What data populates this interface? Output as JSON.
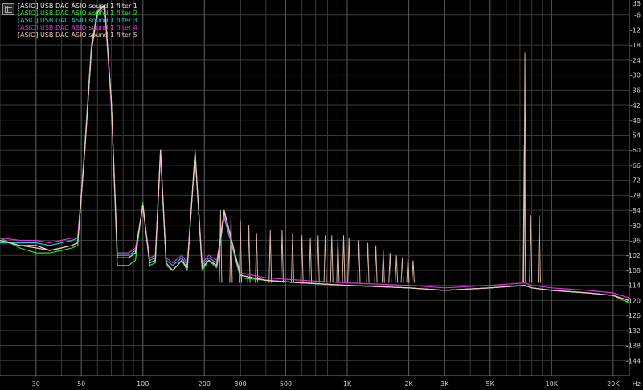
{
  "chart_data": {
    "type": "line",
    "ylabel": "dB",
    "xlabel": "Hz",
    "x_scale": "log",
    "xlim": [
      20,
      24000
    ],
    "ylim": [
      -150,
      0
    ],
    "grid": true,
    "legend_position": "top-left",
    "xticks": [
      {
        "value": 30,
        "label": "30"
      },
      {
        "value": 50,
        "label": "50"
      },
      {
        "value": 100,
        "label": "100"
      },
      {
        "value": 200,
        "label": "200"
      },
      {
        "value": 300,
        "label": "300"
      },
      {
        "value": 500,
        "label": "500"
      },
      {
        "value": 1000,
        "label": "1K"
      },
      {
        "value": 2000,
        "label": "2K"
      },
      {
        "value": 3000,
        "label": "3K"
      },
      {
        "value": 5000,
        "label": "5K"
      },
      {
        "value": 10000,
        "label": "10K"
      },
      {
        "value": 20000,
        "label": "20K"
      }
    ],
    "yticks": [
      "-6",
      "-12",
      "-18",
      "-24",
      "-30",
      "-36",
      "-42",
      "-48",
      "-54",
      "-60",
      "-66",
      "-72",
      "-78",
      "-84",
      "-90",
      "-96",
      "-102",
      "-108",
      "-114",
      "-120",
      "-126",
      "-132",
      "-138",
      "-144"
    ],
    "series": [
      {
        "name": "[ASIO] USB DAC ASIO sound 1 filter 1",
        "color": "#e8e8e8",
        "points": [
          [
            20,
            -96
          ],
          [
            25,
            -98
          ],
          [
            30,
            -98
          ],
          [
            35,
            -100
          ],
          [
            40,
            -99
          ],
          [
            45,
            -98
          ],
          [
            48,
            -97
          ],
          [
            52,
            -60
          ],
          [
            56,
            -20
          ],
          [
            60,
            -5
          ],
          [
            65,
            -2
          ],
          [
            70,
            -40
          ],
          [
            75,
            -103
          ],
          [
            85,
            -103
          ],
          [
            92,
            -101
          ],
          [
            100,
            -82
          ],
          [
            108,
            -105
          ],
          [
            115,
            -104
          ],
          [
            122,
            -60
          ],
          [
            130,
            -105
          ],
          [
            140,
            -108
          ],
          [
            155,
            -104
          ],
          [
            165,
            -107
          ],
          [
            180,
            -61
          ],
          [
            195,
            -107
          ],
          [
            210,
            -104
          ],
          [
            230,
            -106
          ],
          [
            250,
            -85
          ],
          [
            300,
            -110
          ],
          [
            400,
            -112
          ],
          [
            600,
            -113
          ],
          [
            1000,
            -114
          ],
          [
            2000,
            -115
          ],
          [
            3000,
            -116
          ],
          [
            5000,
            -115
          ],
          [
            7400,
            -114
          ],
          [
            8000,
            -115
          ],
          [
            10000,
            -116
          ],
          [
            15000,
            -117
          ],
          [
            20000,
            -118
          ],
          [
            24000,
            -120
          ]
        ]
      },
      {
        "name": "[ASIO] USB DAC ASIO sound 1 filter 2",
        "color": "#33dd33",
        "points": [
          [
            20,
            -95
          ],
          [
            25,
            -99
          ],
          [
            30,
            -101
          ],
          [
            35,
            -101
          ],
          [
            40,
            -100
          ],
          [
            45,
            -99
          ],
          [
            48,
            -98
          ],
          [
            52,
            -58
          ],
          [
            56,
            -18
          ],
          [
            60,
            -4
          ],
          [
            65,
            -2
          ],
          [
            70,
            -40
          ],
          [
            75,
            -106
          ],
          [
            85,
            -106
          ],
          [
            92,
            -104
          ],
          [
            100,
            -81
          ],
          [
            108,
            -106
          ],
          [
            115,
            -105
          ],
          [
            122,
            -61
          ],
          [
            130,
            -106
          ],
          [
            140,
            -108
          ],
          [
            155,
            -104
          ],
          [
            165,
            -108
          ],
          [
            180,
            -60
          ],
          [
            195,
            -108
          ],
          [
            210,
            -104
          ],
          [
            230,
            -107
          ],
          [
            250,
            -86
          ],
          [
            300,
            -111
          ],
          [
            400,
            -112
          ],
          [
            600,
            -113
          ],
          [
            1000,
            -114
          ],
          [
            2000,
            -115
          ],
          [
            3000,
            -116
          ],
          [
            5000,
            -115
          ],
          [
            7400,
            -114
          ],
          [
            8000,
            -115
          ],
          [
            10000,
            -116
          ],
          [
            15000,
            -117
          ],
          [
            20000,
            -118
          ],
          [
            24000,
            -121
          ]
        ]
      },
      {
        "name": "[ASIO] USB DAC ASIO sound 1 filter 3",
        "color": "#22cccc",
        "points": [
          [
            20,
            -97
          ],
          [
            25,
            -97
          ],
          [
            30,
            -97
          ],
          [
            35,
            -98
          ],
          [
            40,
            -97
          ],
          [
            45,
            -96
          ],
          [
            48,
            -95
          ],
          [
            52,
            -59
          ],
          [
            56,
            -19
          ],
          [
            60,
            -6
          ],
          [
            65,
            -3
          ],
          [
            70,
            -41
          ],
          [
            75,
            -102
          ],
          [
            85,
            -102
          ],
          [
            92,
            -100
          ],
          [
            100,
            -83
          ],
          [
            108,
            -104
          ],
          [
            115,
            -103
          ],
          [
            122,
            -62
          ],
          [
            130,
            -104
          ],
          [
            140,
            -106
          ],
          [
            155,
            -103
          ],
          [
            165,
            -106
          ],
          [
            180,
            -62
          ],
          [
            195,
            -106
          ],
          [
            210,
            -103
          ],
          [
            230,
            -105
          ],
          [
            250,
            -87
          ],
          [
            300,
            -110
          ],
          [
            400,
            -112
          ],
          [
            600,
            -113
          ],
          [
            1000,
            -114
          ],
          [
            2000,
            -115
          ],
          [
            3000,
            -116
          ],
          [
            5000,
            -115
          ],
          [
            7400,
            -114
          ],
          [
            8000,
            -115
          ],
          [
            10000,
            -116
          ],
          [
            15000,
            -117
          ],
          [
            20000,
            -118
          ],
          [
            24000,
            -120
          ]
        ]
      },
      {
        "name": "[ASIO] USB DAC ASIO sound 1 filter 4",
        "color": "#dd33dd",
        "points": [
          [
            20,
            -95
          ],
          [
            25,
            -96
          ],
          [
            30,
            -96
          ],
          [
            35,
            -97
          ],
          [
            40,
            -96
          ],
          [
            45,
            -95
          ],
          [
            48,
            -95
          ],
          [
            52,
            -60
          ],
          [
            56,
            -20
          ],
          [
            60,
            -6
          ],
          [
            65,
            -3
          ],
          [
            70,
            -42
          ],
          [
            75,
            -101
          ],
          [
            85,
            -101
          ],
          [
            92,
            -99
          ],
          [
            100,
            -83
          ],
          [
            108,
            -103
          ],
          [
            115,
            -102
          ],
          [
            122,
            -62
          ],
          [
            130,
            -103
          ],
          [
            140,
            -105
          ],
          [
            155,
            -102
          ],
          [
            165,
            -105
          ],
          [
            180,
            -62
          ],
          [
            195,
            -105
          ],
          [
            210,
            -102
          ],
          [
            230,
            -104
          ],
          [
            250,
            -86
          ],
          [
            300,
            -109
          ],
          [
            400,
            -111
          ],
          [
            600,
            -112
          ],
          [
            1000,
            -113
          ],
          [
            2000,
            -114
          ],
          [
            3000,
            -115
          ],
          [
            5000,
            -114
          ],
          [
            7400,
            -113
          ],
          [
            8000,
            -114
          ],
          [
            10000,
            -115
          ],
          [
            15000,
            -116
          ],
          [
            20000,
            -117
          ],
          [
            24000,
            -119
          ]
        ]
      },
      {
        "name": "[ASIO] USB DAC ASIO sound 1 filter 5",
        "color": "#f0c8b4",
        "points": [
          [
            20,
            -96
          ],
          [
            25,
            -98
          ],
          [
            30,
            -99
          ],
          [
            35,
            -100
          ],
          [
            40,
            -99
          ],
          [
            45,
            -98
          ],
          [
            48,
            -97
          ],
          [
            52,
            -60
          ],
          [
            56,
            -20
          ],
          [
            60,
            -5
          ],
          [
            65,
            -2
          ],
          [
            70,
            -40
          ],
          [
            75,
            -103
          ],
          [
            85,
            -103
          ],
          [
            92,
            -101
          ],
          [
            100,
            -82
          ],
          [
            108,
            -105
          ],
          [
            115,
            -104
          ],
          [
            122,
            -60
          ],
          [
            130,
            -105
          ],
          [
            140,
            -108
          ],
          [
            155,
            -104
          ],
          [
            165,
            -107
          ],
          [
            180,
            -61
          ],
          [
            195,
            -107
          ],
          [
            210,
            -104
          ],
          [
            230,
            -106
          ],
          [
            250,
            -84
          ],
          [
            300,
            -110
          ],
          [
            400,
            -112
          ],
          [
            600,
            -113
          ],
          [
            1000,
            -114
          ],
          [
            2000,
            -115
          ],
          [
            3000,
            -116
          ],
          [
            5000,
            -115
          ],
          [
            7400,
            -114
          ],
          [
            8000,
            -115
          ],
          [
            10000,
            -116
          ],
          [
            15000,
            -117
          ],
          [
            20000,
            -118
          ],
          [
            24000,
            -120
          ]
        ]
      }
    ],
    "harmonic_peaks": [
      {
        "x": 240,
        "y": -84
      },
      {
        "x": 270,
        "y": -86
      },
      {
        "x": 300,
        "y": -88
      },
      {
        "x": 330,
        "y": -90
      },
      {
        "x": 360,
        "y": -93
      },
      {
        "x": 420,
        "y": -92
      },
      {
        "x": 480,
        "y": -92
      },
      {
        "x": 540,
        "y": -93
      },
      {
        "x": 600,
        "y": -94
      },
      {
        "x": 660,
        "y": -95
      },
      {
        "x": 720,
        "y": -94
      },
      {
        "x": 780,
        "y": -94
      },
      {
        "x": 840,
        "y": -94
      },
      {
        "x": 900,
        "y": -95
      },
      {
        "x": 960,
        "y": -94
      },
      {
        "x": 1020,
        "y": -95
      },
      {
        "x": 1140,
        "y": -96
      },
      {
        "x": 1260,
        "y": -97
      },
      {
        "x": 1380,
        "y": -98
      },
      {
        "x": 1500,
        "y": -100
      },
      {
        "x": 1620,
        "y": -101
      },
      {
        "x": 1740,
        "y": -102
      },
      {
        "x": 1860,
        "y": -103
      },
      {
        "x": 1980,
        "y": -103
      },
      {
        "x": 2100,
        "y": -104
      },
      {
        "x": 7400,
        "y": -21
      },
      {
        "x": 7350,
        "y": -58
      },
      {
        "x": 7900,
        "y": -86
      },
      {
        "x": 8700,
        "y": -86
      }
    ]
  }
}
